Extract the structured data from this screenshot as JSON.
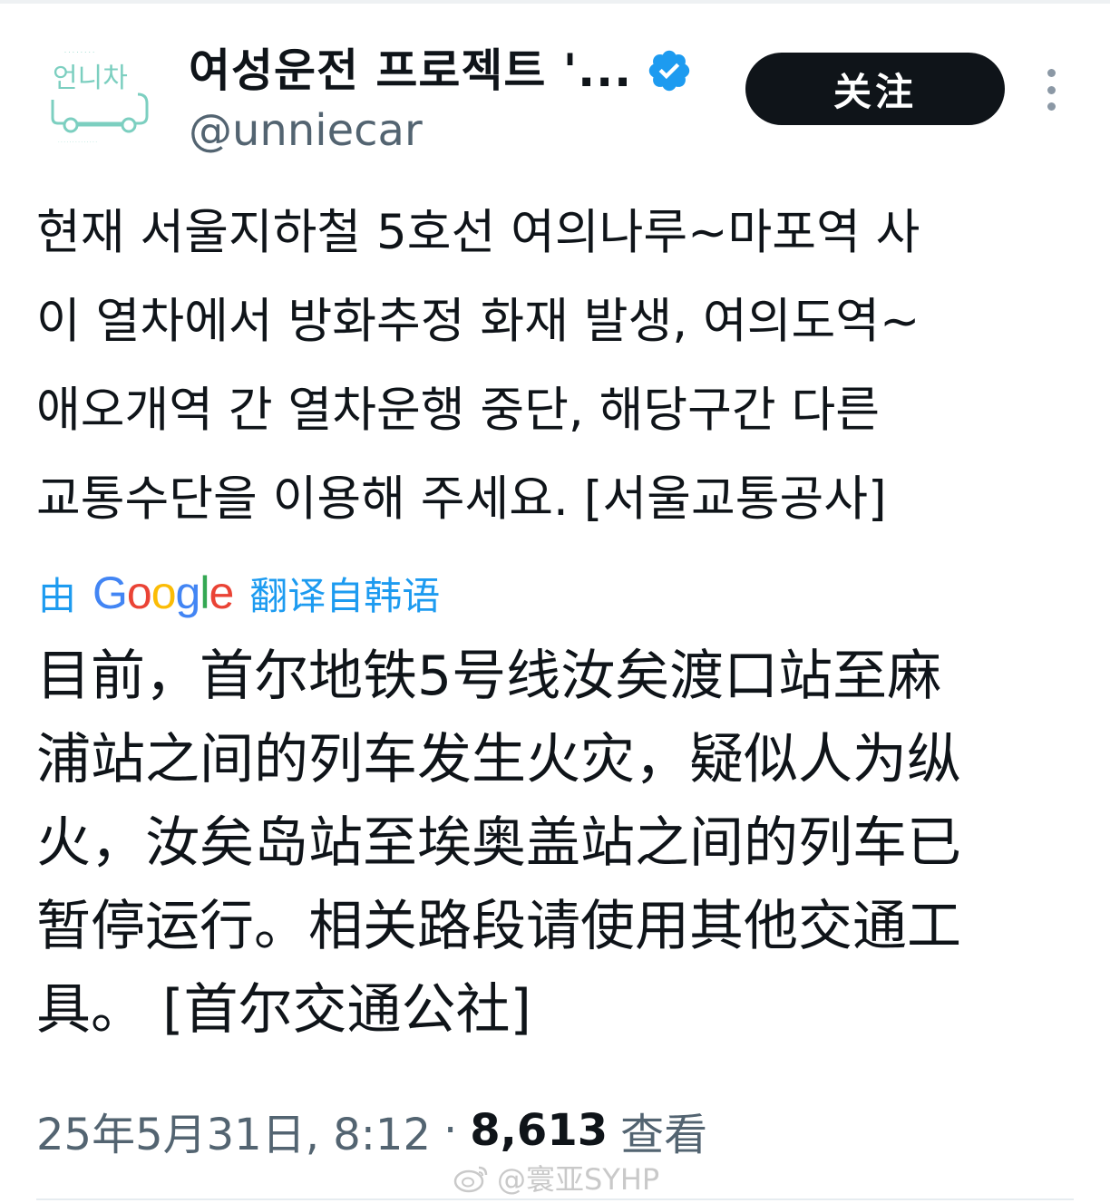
{
  "account": {
    "display_name": "여성운전 프로젝트 '...",
    "handle": "@unniecar",
    "avatar_logo_text": "언니차",
    "verified": true
  },
  "actions": {
    "follow_label": "关注"
  },
  "tweet": {
    "lines": [
      "현재 서울지하철 5호선 여의나루~마포역 사",
      "이 열차에서 방화추정 화재 발생, 여의도역~",
      "애오개역 간 열차운행 중단, 해당구간 다른",
      "교통수단을 이용해 주세요. [서울교통공사]"
    ]
  },
  "translation": {
    "prefix": "由",
    "google_letters": [
      "G",
      "o",
      "o",
      "g",
      "l",
      "e"
    ],
    "suffix": "翻译自韩语",
    "lines": [
      "目前，首尔地铁5号线汝矣渡口站至麻",
      "浦站之间的列车发生火灾，疑似人为纵",
      "火，汝矣岛站至埃奥盖站之间的列车已",
      "暂停运行。相关路段请使用其他交通工",
      "具。 [首尔交通公社]"
    ]
  },
  "meta": {
    "date_time": "25年5月31日, 8:12",
    "separator": "·",
    "views_count": "8,613",
    "views_label": "查看"
  },
  "watermark": {
    "text": "@寰亚SYHP"
  },
  "colors": {
    "text": "#0f1419",
    "secondary": "#536471",
    "link": "#1d9bf0",
    "verified": "#1d9bf0",
    "follow_bg": "#0f1419",
    "avatar_teal": "#7ccfc0"
  }
}
